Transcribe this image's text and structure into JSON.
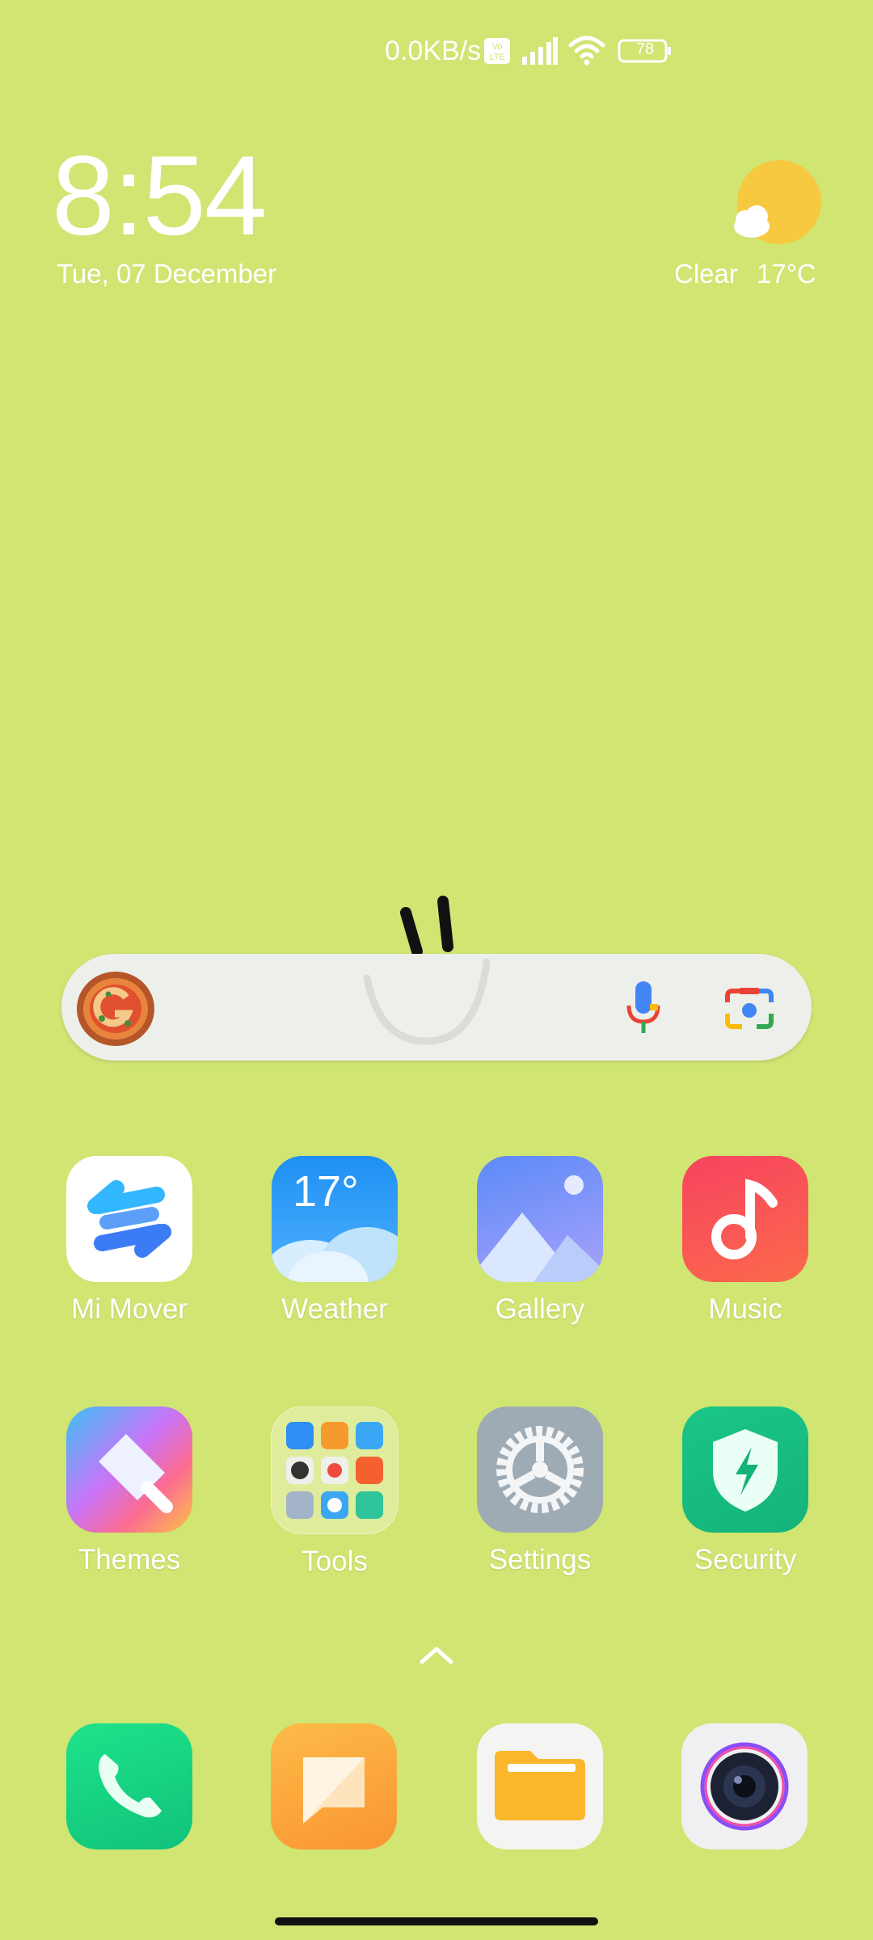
{
  "status_bar": {
    "net_speed": "0.0KB/s",
    "volte_icon": "volte-icon",
    "signal_icon": "signal-icon",
    "wifi_icon": "wifi-icon",
    "battery_level": "78"
  },
  "clock_widget": {
    "time": "8:54",
    "date": "Tue, 07 December"
  },
  "weather_widget": {
    "icon": "sun-cloud-icon",
    "condition": "Clear",
    "temperature": "17°C"
  },
  "search_bar": {
    "logo": "google-doodle-icon",
    "mic_icon": "mic-icon",
    "lens_icon": "lens-icon"
  },
  "apps": [
    {
      "label": "Mi Mover",
      "icon": "mi-mover-icon"
    },
    {
      "label": "Weather",
      "icon": "weather-app-icon",
      "icon_text": "17°"
    },
    {
      "label": "Gallery",
      "icon": "gallery-icon"
    },
    {
      "label": "Music",
      "icon": "music-icon"
    },
    {
      "label": "Themes",
      "icon": "themes-icon"
    },
    {
      "label": "Tools",
      "icon": "tools-folder-icon"
    },
    {
      "label": "Settings",
      "icon": "settings-icon"
    },
    {
      "label": "Security",
      "icon": "security-icon"
    }
  ],
  "dock": [
    {
      "icon": "phone-icon"
    },
    {
      "icon": "messages-icon"
    },
    {
      "icon": "files-icon"
    },
    {
      "icon": "camera-icon"
    }
  ],
  "colors": {
    "wallpaper": "#d0e572",
    "text": "#ffffff"
  }
}
